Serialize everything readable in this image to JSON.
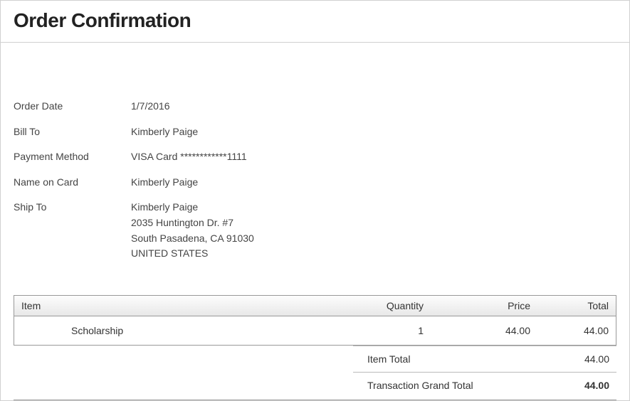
{
  "title": "Order Confirmation",
  "details": {
    "orderDate": {
      "label": "Order Date",
      "value": "1/7/2016"
    },
    "billTo": {
      "label": "Bill To",
      "value": "Kimberly Paige"
    },
    "paymentMethod": {
      "label": "Payment Method",
      "value": "VISA Card ************1111"
    },
    "nameOnCard": {
      "label": "Name on Card",
      "value": "Kimberly Paige"
    },
    "shipTo": {
      "label": "Ship To",
      "name": "Kimberly Paige",
      "address1": "2035 Huntington Dr. #7",
      "cityStateZip": "South Pasadena, CA 91030",
      "country": "UNITED STATES"
    }
  },
  "columns": {
    "item": "Item",
    "quantity": "Quantity",
    "price": "Price",
    "total": "Total"
  },
  "lineItems": {
    "name": "Scholarship",
    "quantity": "1",
    "price": "44.00",
    "total": "44.00"
  },
  "totals": {
    "itemTotal": {
      "label": "Item Total",
      "value": "44.00"
    },
    "grandTotal": {
      "label": "Transaction Grand Total",
      "value": "44.00"
    }
  }
}
